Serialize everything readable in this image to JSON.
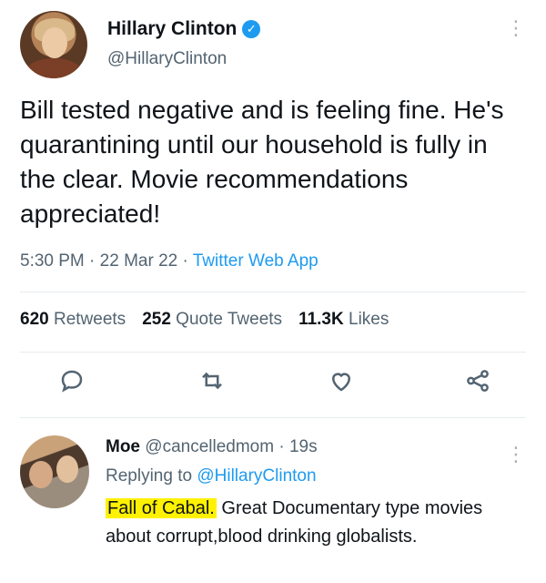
{
  "tweet": {
    "author_name": "Hillary Clinton",
    "handle": "@HillaryClinton",
    "text": "Bill tested negative and is feeling fine. He's quarantining until our household is fully in the clear. Movie recommendations appreciated!",
    "time": "5:30 PM",
    "date": "22 Mar 22",
    "separator": "·",
    "app": "Twitter Web App",
    "verified_symbol": "✓",
    "more_symbol": "⋮"
  },
  "stats": {
    "retweets_count": "620",
    "retweets_label": "Retweets",
    "quotes_count": "252",
    "quotes_label": "Quote Tweets",
    "likes_count": "11.3K",
    "likes_label": "Likes"
  },
  "actions": [
    "reply-icon",
    "retweet-icon",
    "like-icon",
    "share-icon"
  ],
  "reply": {
    "author_name": "Moe",
    "handle": "@cancelledmom",
    "separator": "·",
    "age": "19s",
    "replying_label": "Replying to",
    "replying_to": "@HillaryClinton",
    "highlight_text": "Fall of Cabal.",
    "text": " Great Documentary type movies about corrupt,blood drinking globalists.",
    "more_symbol": "⋮"
  },
  "colors": {
    "accent": "#1d9bf0",
    "muted": "#536471",
    "highlight": "#fff200"
  }
}
